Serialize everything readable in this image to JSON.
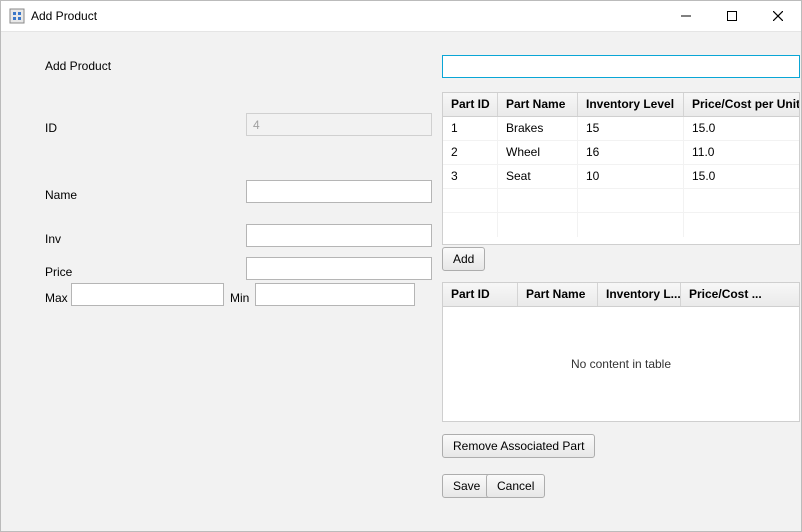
{
  "window": {
    "title": "Add Product"
  },
  "header": {
    "title": "Add Product"
  },
  "form": {
    "id_label": "ID",
    "id_value": "4",
    "name_label": "Name",
    "name_value": "",
    "inv_label": "Inv",
    "inv_value": "",
    "price_label": "Price",
    "price_value": "",
    "max_label": "Max",
    "max_value": "",
    "min_label": "Min",
    "min_value": ""
  },
  "search": {
    "value": ""
  },
  "parts_table": {
    "headers": {
      "part_id": "Part ID",
      "part_name": "Part Name",
      "inventory": "Inventory Level",
      "price": "Price/Cost per Unit"
    },
    "rows": [
      {
        "id": "1",
        "name": "Brakes",
        "inv": "15",
        "price": "15.0"
      },
      {
        "id": "2",
        "name": "Wheel",
        "inv": "16",
        "price": "11.0"
      },
      {
        "id": "3",
        "name": "Seat",
        "inv": "10",
        "price": "15.0"
      }
    ]
  },
  "assoc_table": {
    "headers": {
      "part_id": "Part ID",
      "part_name": "Part Name",
      "inventory": "Inventory L...",
      "price": "Price/Cost ..."
    },
    "empty_text": "No content in table"
  },
  "buttons": {
    "add": "Add",
    "remove": "Remove Associated Part",
    "save": "Save",
    "cancel": "Cancel"
  }
}
